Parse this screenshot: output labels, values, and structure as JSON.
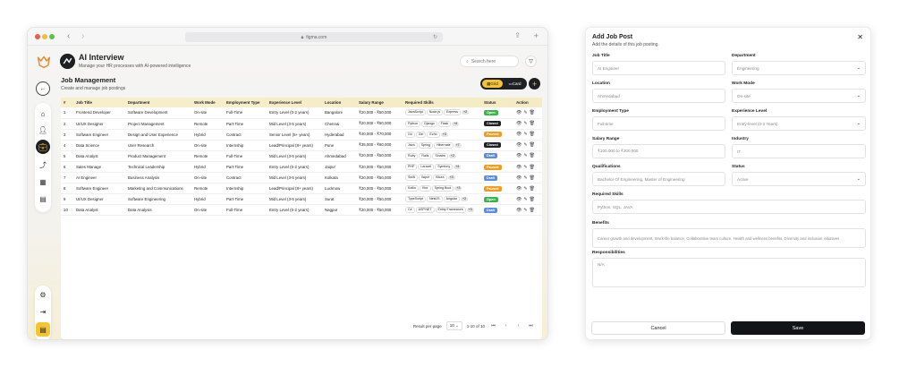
{
  "browser": {
    "url": "figma.com"
  },
  "app": {
    "title": "AI Interview",
    "subtitle": "Manage your HR processes with AI-powered intelligence",
    "search_placeholder": "Search here"
  },
  "page": {
    "title": "Job Management",
    "subtitle": "Create and manage job postings"
  },
  "view_toggle": {
    "grid": "Grid",
    "card": "Card"
  },
  "colors": {
    "accent": "#f3c532",
    "dark": "#1f2024",
    "open": "#3bb54a",
    "closed": "#1f2024",
    "paused": "#f29b1d",
    "draft": "#5b8de0"
  },
  "table": {
    "headers": [
      "#",
      "Job Title",
      "Department",
      "Work Mode",
      "Employment Type",
      "Experience Level",
      "Location",
      "Salary Range",
      "Required Skills",
      "Status",
      "Action"
    ],
    "rows": [
      {
        "n": "1",
        "title": "Frontend Developer",
        "dept": "Software Development",
        "mode": "On-site",
        "type": "Full-Time",
        "level": "Entry Level (0-2 years)",
        "loc": "Bangalore",
        "salary": "₹20,000 - ₹50,000",
        "skills": [
          "JavaScript",
          "Node.js",
          "Express"
        ],
        "more": "+2",
        "status": "Open"
      },
      {
        "n": "2",
        "title": "UI/UX Designer",
        "dept": "Project Management",
        "mode": "Remote",
        "type": "Part-Time",
        "level": "Mid Level (3-5 years)",
        "loc": "Chennai",
        "salary": "₹20,000 - ₹50,000",
        "skills": [
          "Python",
          "Django",
          "Flask"
        ],
        "more": "+4",
        "status": "Closed"
      },
      {
        "n": "3",
        "title": "Software Engineer",
        "dept": "Design and User Experience",
        "mode": "Hybrid",
        "type": "Contract",
        "level": "Senior Level (5+ years)",
        "loc": "Hyderabad",
        "salary": "₹40,000 - ₹70,000",
        "skills": [
          "Go",
          "Gin",
          "Echo"
        ],
        "more": "+3",
        "status": "Paused"
      },
      {
        "n": "4",
        "title": "Data Science",
        "dept": "User Research",
        "mode": "On-site",
        "type": "Internship",
        "level": "Lead/Principal (8+ years)",
        "loc": "Pune",
        "salary": "₹35,000 - ₹60,000",
        "skills": [
          "Java",
          "Spring",
          "Hibernate"
        ],
        "more": "+7",
        "status": "Closed"
      },
      {
        "n": "5",
        "title": "Data Analyst",
        "dept": "Product Management",
        "mode": "Remote",
        "type": "Full-Time",
        "level": "Mid Level (3-5 years)",
        "loc": "Ahmedabad",
        "salary": "₹20,000 - ₹50,000",
        "skills": [
          "Ruby",
          "Rails",
          "Sinatra"
        ],
        "more": "+2",
        "status": "Draft"
      },
      {
        "n": "6",
        "title": "Sales Manage",
        "dept": "Technical Leadership",
        "mode": "Hybrid",
        "type": "Part-Time",
        "level": "Entry Level (0-2 years)",
        "loc": "Jaipur",
        "salary": "₹20,000 - ₹50,000",
        "skills": [
          "PHP",
          "Laravel",
          "Symfony"
        ],
        "more": "+4",
        "status": "Paused"
      },
      {
        "n": "7",
        "title": "AI Engineer",
        "dept": "Business Analysis",
        "mode": "On-site",
        "type": "Contract",
        "level": "Mid Level (3-5 years)",
        "loc": "Kolkata",
        "salary": "₹20,000 - ₹50,000",
        "skills": [
          "Swift",
          "Vapor",
          "Kitura"
        ],
        "more": "+3",
        "status": "Draft"
      },
      {
        "n": "8",
        "title": "Software Engineer",
        "dept": "Marketing and Communications",
        "mode": "Remote",
        "type": "Internship",
        "level": "Lead/Principal (8+ years)",
        "loc": "Lucknow",
        "salary": "₹20,000 - ₹50,000",
        "skills": [
          "Kotlin",
          "Ktor",
          "Spring Boot"
        ],
        "more": "+3",
        "status": "Paused"
      },
      {
        "n": "9",
        "title": "UI/UX Designer",
        "dept": "Software Engineering",
        "mode": "Hybrid",
        "type": "Part-Time",
        "level": "Mid Level (3-5 years)",
        "loc": "Surat",
        "salary": "₹20,000 - ₹50,000",
        "skills": [
          "TypeScript",
          "NestJS",
          "Angular"
        ],
        "more": "+2",
        "status": "Open"
      },
      {
        "n": "10",
        "title": "Data Analyst",
        "dept": "Data Analysis",
        "mode": "On-site",
        "type": "Full-Time",
        "level": "Entry Level (0-2 years)",
        "loc": "Nagpur",
        "salary": "₹20,000 - ₹50,000",
        "skills": [
          "C#",
          "ASP.NET",
          "Entity Framework"
        ],
        "more": "+3",
        "status": "Draft"
      }
    ]
  },
  "pager": {
    "label": "Result per page",
    "per_page": "10",
    "range": "1-10 of 10"
  },
  "modal": {
    "title": "Add Job Post",
    "subtitle": "Add the details of this job posting.",
    "job_title": {
      "label": "Job Title",
      "placeholder": "AI Engineer"
    },
    "department": {
      "label": "Department",
      "value": "Engineering"
    },
    "location": {
      "label": "Location",
      "placeholder": "Ahmedabad"
    },
    "work_mode": {
      "label": "Work Mode",
      "value": "On-site"
    },
    "employment_type": {
      "label": "Employment Type",
      "placeholder": "Full-time"
    },
    "experience_level": {
      "label": "Experience Level",
      "value": "Entry-level (0-2 Years)"
    },
    "salary_range": {
      "label": "Salary Range",
      "placeholder": "₹100,000 to ₹200,000"
    },
    "industry": {
      "label": "Industry",
      "placeholder": "IT"
    },
    "qualifications": {
      "label": "Qualifications",
      "placeholder": "Bachelor Of Engineering, Master of Engineering"
    },
    "status": {
      "label": "Status",
      "value": "Active"
    },
    "required_skills": {
      "label": "Required Skills",
      "placeholder": "Python, SQL, JAVA"
    },
    "benefits": {
      "label": "Benefits",
      "placeholder": "Career growth and development, Work-life balance, Collaborative team culture, Health and wellness benefits, Diversity and inclusion initiatives"
    },
    "responsibilities": {
      "label": "Responsibilities",
      "placeholder": "N/A"
    },
    "cancel": "Cancel",
    "save": "Save"
  }
}
